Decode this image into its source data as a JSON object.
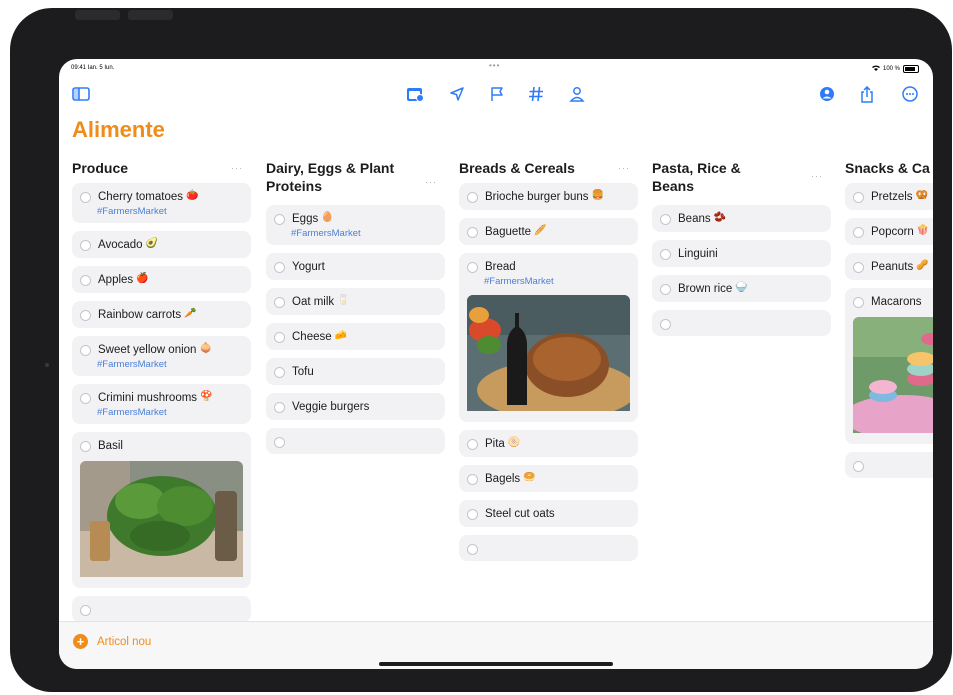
{
  "status": {
    "time": "09:41 Ian. 5 Iun.",
    "dots": "•••",
    "wifi_battery": "100 %"
  },
  "toolbar": {
    "sidebar_icon": "sidebar-icon",
    "icons": [
      "calendar-badge-icon",
      "location-arrow-icon",
      "flag-icon",
      "hashtag-icon",
      "person-icon"
    ],
    "right_icons": [
      "share-person-icon",
      "share-icon",
      "more-circle-icon"
    ]
  },
  "list_title": "Alimente",
  "columns": [
    {
      "title": "Produce",
      "more": "···",
      "items": [
        {
          "text": "Cherry tomatoes",
          "emoji": "🍅",
          "tag": "#FarmersMarket"
        },
        {
          "text": "Avocado",
          "emoji": "🥑",
          "tag": ""
        },
        {
          "text": "Apples",
          "emoji": "🍎",
          "tag": ""
        },
        {
          "text": "Rainbow carrots",
          "emoji": "🥕",
          "tag": ""
        },
        {
          "text": "Sweet yellow onion",
          "emoji": "🧅",
          "tag": "#FarmersMarket"
        },
        {
          "text": "Crimini mushrooms",
          "emoji": "🍄",
          "tag": "#FarmersMarket"
        },
        {
          "text": "Basil",
          "emoji": "",
          "tag": ""
        }
      ]
    },
    {
      "title": "Dairy, Eggs & Plant Proteins",
      "more": "···",
      "items": [
        {
          "text": "Eggs",
          "emoji": "🥚",
          "tag": "#FarmersMarket"
        },
        {
          "text": "Yogurt",
          "emoji": "",
          "tag": ""
        },
        {
          "text": "Oat milk",
          "emoji": "🥛",
          "tag": ""
        },
        {
          "text": "Cheese",
          "emoji": "🧀",
          "tag": ""
        },
        {
          "text": "Tofu",
          "emoji": "",
          "tag": ""
        },
        {
          "text": "Veggie burgers",
          "emoji": "",
          "tag": ""
        }
      ]
    },
    {
      "title": "Breads & Cereals",
      "more": "···",
      "items": [
        {
          "text": "Brioche burger buns",
          "emoji": "🍔",
          "tag": ""
        },
        {
          "text": "Baguette",
          "emoji": "🥖",
          "tag": ""
        },
        {
          "text": "Bread",
          "emoji": "",
          "tag": "#FarmersMarket"
        },
        {
          "text": "Pita",
          "emoji": "🫓",
          "tag": ""
        },
        {
          "text": "Bagels",
          "emoji": "🥯",
          "tag": ""
        },
        {
          "text": "Steel cut oats",
          "emoji": "",
          "tag": ""
        }
      ]
    },
    {
      "title": "Pasta, Rice & Beans",
      "more": "···",
      "items": [
        {
          "text": "Beans",
          "emoji": "🫘",
          "tag": ""
        },
        {
          "text": "Linguini",
          "emoji": "",
          "tag": ""
        },
        {
          "text": "Brown rice",
          "emoji": "🍚",
          "tag": ""
        }
      ]
    },
    {
      "title": "Snacks & Ca",
      "more": "",
      "items": [
        {
          "text": "Pretzels",
          "emoji": "🥨",
          "tag": ""
        },
        {
          "text": "Popcorn",
          "emoji": "🍿",
          "tag": ""
        },
        {
          "text": "Peanuts",
          "emoji": "🥜",
          "tag": ""
        },
        {
          "text": "Macarons",
          "emoji": "",
          "tag": ""
        }
      ]
    }
  ],
  "bottom": {
    "new_item_label": "Articol nou"
  },
  "colors": {
    "accent": "#f08c1a",
    "toolbar_blue": "#2f7df6",
    "tag_blue": "#4a7fd6",
    "card_bg": "#f2f2f5"
  }
}
